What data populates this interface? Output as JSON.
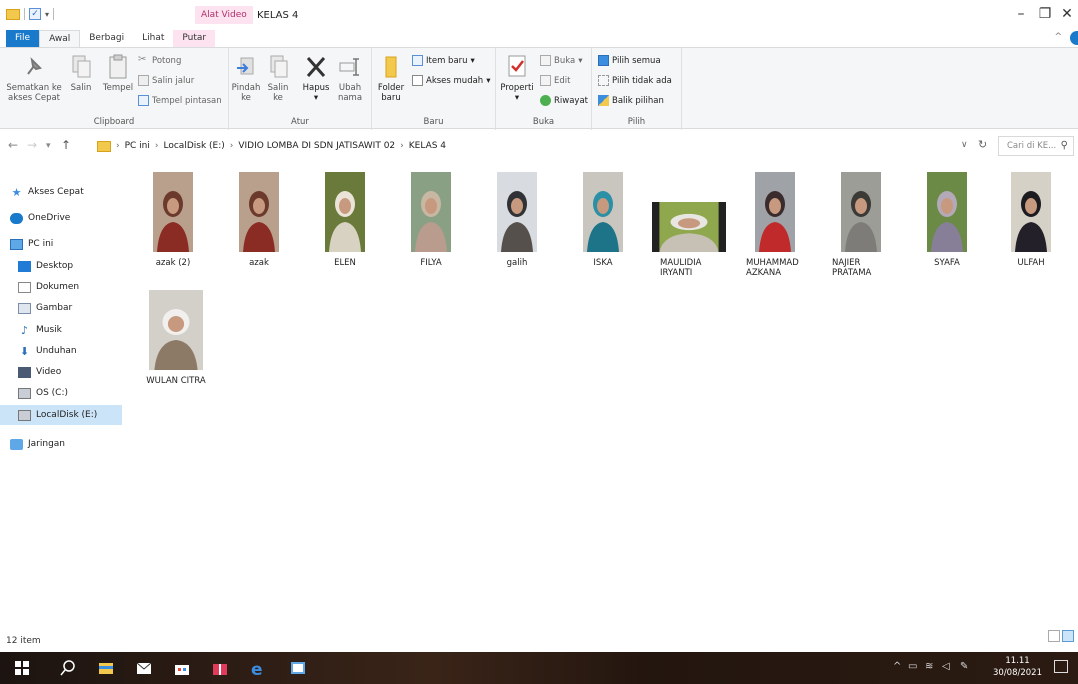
{
  "window": {
    "title": "KELAS 4",
    "context_tab": "Alat Video"
  },
  "tabs": [
    "File",
    "Awal",
    "Berbagi",
    "Lihat",
    "Putar"
  ],
  "ribbon": {
    "clipboard": {
      "label": "Clipboard",
      "pin": [
        "Sematkan ke",
        "akses Cepat"
      ],
      "copy": "Salin",
      "paste": "Tempel",
      "cut": "Potong",
      "copy_path": "Salin jalur",
      "paste_shortcut": "Tempel pintasan"
    },
    "organize": {
      "label": "Atur",
      "move": [
        "Pindah",
        "ke"
      ],
      "copyto": [
        "Salin",
        "ke"
      ],
      "delete": "Hapus",
      "rename": [
        "Ubah",
        "nama"
      ]
    },
    "new": {
      "label": "Baru",
      "folder": [
        "Folder",
        "baru"
      ],
      "new_item": "Item baru",
      "easy_access": "Akses mudah"
    },
    "open": {
      "label": "Buka",
      "properties": "Properti",
      "open": "Buka",
      "edit": "Edit",
      "history": "Riwayat"
    },
    "select": {
      "label": "Pilih",
      "select_all": "Pilih semua",
      "select_none": "Pilih tidak ada",
      "invert": "Balik pilihan"
    }
  },
  "address": {
    "crumbs": [
      "PC ini",
      "LocalDisk (E:)",
      "VIDIO LOMBA DI SDN JATISAWIT 02",
      "KELAS 4"
    ],
    "search_placeholder": "Cari di KE..."
  },
  "nav": [
    {
      "label": "Akses Cepat",
      "icon": "star-icon"
    },
    {
      "label": "OneDrive",
      "icon": "cloud-icon"
    },
    {
      "label": "PC ini",
      "icon": "computer-icon"
    },
    {
      "label": "Desktop",
      "icon": "desktop-icon"
    },
    {
      "label": "Dokumen",
      "icon": "document-icon"
    },
    {
      "label": "Gambar",
      "icon": "picture-icon"
    },
    {
      "label": "Musik",
      "icon": "music-icon"
    },
    {
      "label": "Unduhan",
      "icon": "download-icon"
    },
    {
      "label": "Video",
      "icon": "video-icon"
    },
    {
      "label": "OS (C:)",
      "icon": "drive-icon"
    },
    {
      "label": "LocalDisk (E:)",
      "icon": "drive-icon"
    },
    {
      "label": "Jaringan",
      "icon": "network-icon"
    }
  ],
  "files": [
    {
      "name": "azak (2)",
      "colors": [
        "#b9a08c",
        "#6b3a2c",
        "#8b2c24"
      ]
    },
    {
      "name": "azak",
      "colors": [
        "#b9a08c",
        "#6b3a2c",
        "#8b2c24"
      ]
    },
    {
      "name": "ELEN",
      "colors": [
        "#6a7a3a",
        "#e9e4d7",
        "#d8d2c2"
      ]
    },
    {
      "name": "FILYA",
      "colors": [
        "#8aa085",
        "#c8b7a2",
        "#b99c8e"
      ]
    },
    {
      "name": "galih",
      "colors": [
        "#d8dbe0",
        "#303236",
        "#56504c"
      ]
    },
    {
      "name": "ISKA",
      "colors": [
        "#c9c6c0",
        "#2b8fa5",
        "#1d7488"
      ]
    },
    {
      "name": "MAULIDIA IRYANTI",
      "colors": [
        "#8fa84d",
        "#e8e6e0",
        "#c7c0b4"
      ]
    },
    {
      "name": "MUHAMMAD AZKANA",
      "colors": [
        "#9fa2a6",
        "#3a2c2c",
        "#c02a2a"
      ]
    },
    {
      "name": "NAJIER PRATAMA",
      "colors": [
        "#9d9d98",
        "#3b3a36",
        "#7d7c78"
      ]
    },
    {
      "name": "SYAFA",
      "colors": [
        "#6a8a46",
        "#b4a9b8",
        "#877e97"
      ]
    },
    {
      "name": "ULFAH",
      "colors": [
        "#d6d1c7",
        "#1c1b20",
        "#232029"
      ]
    },
    {
      "name": "WULAN CITRA",
      "colors": [
        "#d3cfc9",
        "#f2f0ee",
        "#8d7a66"
      ]
    }
  ],
  "status": {
    "count": "12 item"
  },
  "clock": {
    "time": "11.11",
    "date": "30/08/2021"
  }
}
